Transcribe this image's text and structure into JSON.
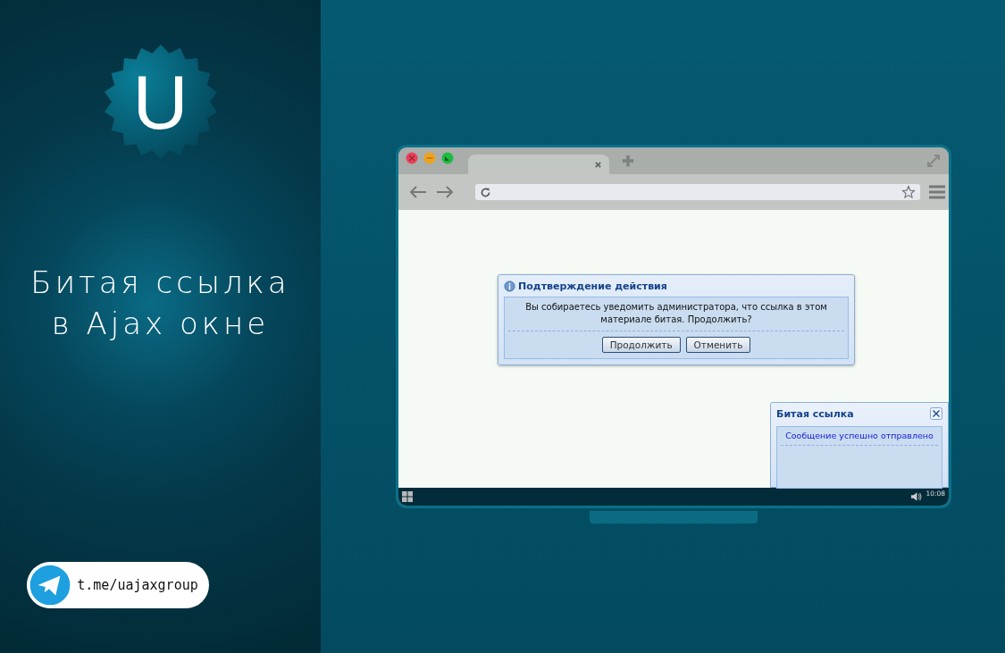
{
  "sidebar": {
    "logo_letter": "U",
    "title_lines": [
      "Битая ссылка",
      "в Ajax окне"
    ],
    "link": "t.me/uajaxgroup"
  },
  "confirm_dialog": {
    "title": "Подтверждение действия",
    "message": "Вы собираетесь уведомить администратора, что ссылка в этом материале битая. Продолжить?",
    "buttons": [
      "Продолжить",
      "Отменить"
    ]
  },
  "notification": {
    "title": "Битая ссылка",
    "message": "Сообщение успешно отправлено"
  },
  "taskbar": {
    "clock": "10:08"
  }
}
